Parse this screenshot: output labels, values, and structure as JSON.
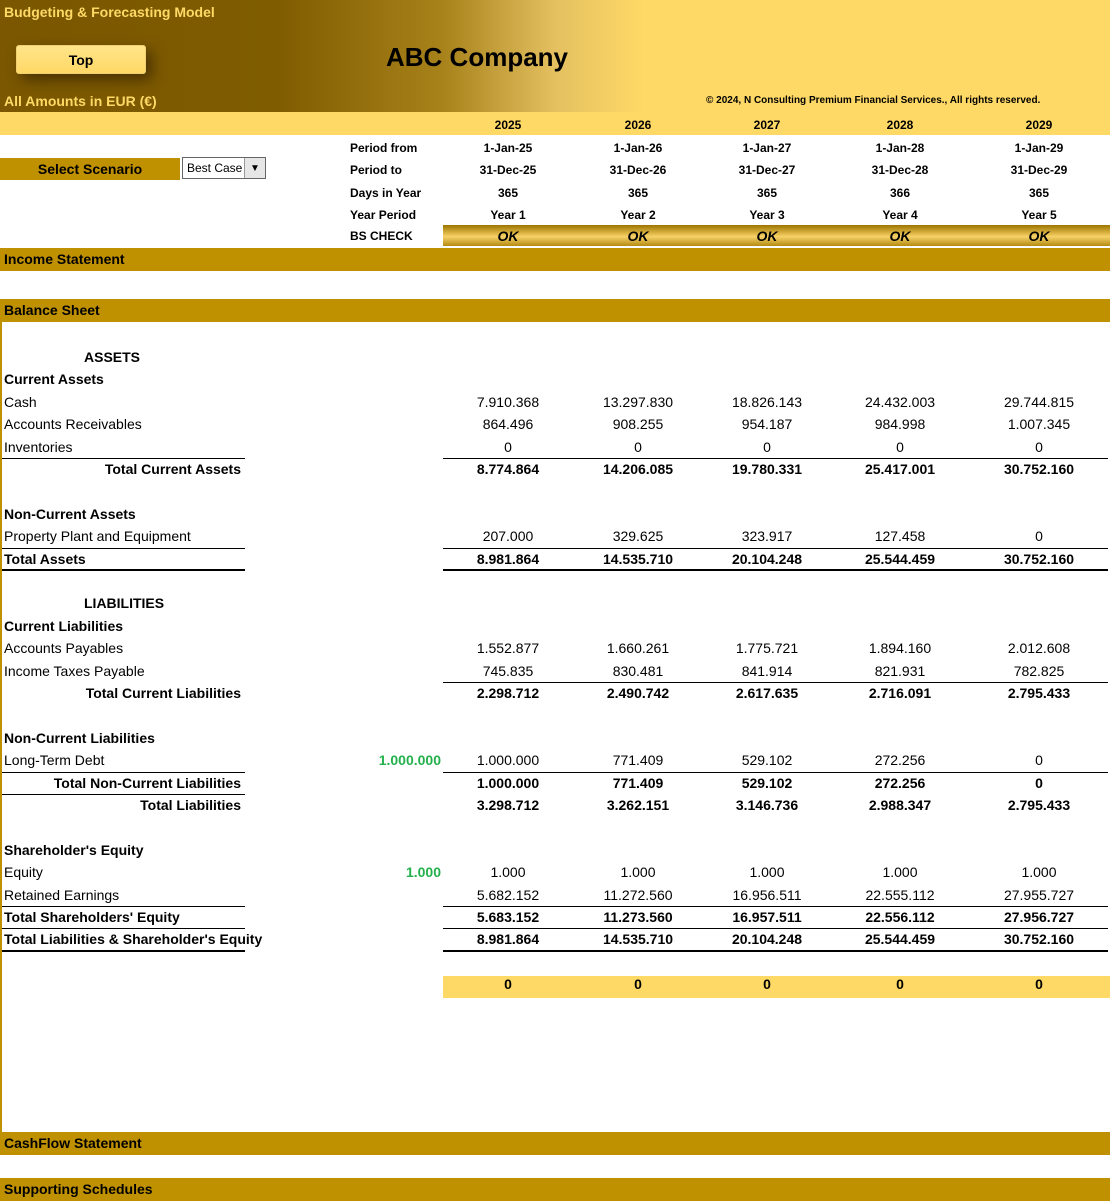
{
  "app_title": "Budgeting & Forecasting  Model",
  "top_button": "Top",
  "company": "ABC Company",
  "amounts_note": "All Amounts in  EUR (€)",
  "copyright": "© 2024, N Consulting Premium Financial Services., All rights reserved.",
  "colors": {
    "gold": "#bf9000",
    "light_gold": "#ffd966",
    "dark_brown": "#7a5700",
    "input_green": "#22b14c"
  },
  "scenario": {
    "label": "Select Scenario",
    "value": "Best Case",
    "icon": "chevron-down-icon"
  },
  "years": [
    "2025",
    "2026",
    "2027",
    "2028",
    "2029"
  ],
  "params": [
    {
      "label": "Period from",
      "values": [
        "1-Jan-25",
        "1-Jan-26",
        "1-Jan-27",
        "1-Jan-28",
        "1-Jan-29"
      ]
    },
    {
      "label": "Period to",
      "values": [
        "31-Dec-25",
        "31-Dec-26",
        "31-Dec-27",
        "31-Dec-28",
        "31-Dec-29"
      ]
    },
    {
      "label": "Days in Year",
      "values": [
        "365",
        "365",
        "365",
        "366",
        "365"
      ]
    },
    {
      "label": "Year Period",
      "values": [
        "Year 1",
        "Year 2",
        "Year 3",
        "Year 4",
        "Year 5"
      ]
    },
    {
      "label": "BS CHECK",
      "values": [
        "OK",
        "OK",
        "OK",
        "OK",
        "OK"
      ]
    }
  ],
  "sections": {
    "income": "Income Statement",
    "balance": "Balance Sheet",
    "cashflow": "CashFlow Statement",
    "supporting": "Supporting Schedules"
  },
  "balance_sheet": [
    {
      "label": "ASSETS",
      "kind": "title"
    },
    {
      "label": "Current Assets",
      "kind": "header"
    },
    {
      "label": "Cash",
      "values": [
        "7.910.368",
        "13.297.830",
        "18.826.143",
        "24.432.003",
        "29.744.815"
      ]
    },
    {
      "label": "Accounts Receivables",
      "values": [
        "864.496",
        "908.255",
        "954.187",
        "984.998",
        "1.007.345"
      ]
    },
    {
      "label": "Inventories",
      "values": [
        "0",
        "0",
        "0",
        "0",
        "0"
      ]
    },
    {
      "label": "Total Current Assets",
      "kind": "total-indent",
      "values": [
        "8.774.864",
        "14.206.085",
        "19.780.331",
        "25.417.001",
        "30.752.160"
      ]
    },
    {
      "label": "Non-Current Assets",
      "kind": "header"
    },
    {
      "label": "Property Plant and Equipment",
      "values": [
        "207.000",
        "329.625",
        "323.917",
        "127.458",
        "0"
      ]
    },
    {
      "label": "Total Assets",
      "kind": "total",
      "values": [
        "8.981.864",
        "14.535.710",
        "20.104.248",
        "25.544.459",
        "30.752.160"
      ]
    },
    {
      "label": "LIABILITIES",
      "kind": "title"
    },
    {
      "label": "Current Liabilities",
      "kind": "header"
    },
    {
      "label": "Accounts Payables",
      "values": [
        "1.552.877",
        "1.660.261",
        "1.775.721",
        "1.894.160",
        "2.012.608"
      ]
    },
    {
      "label": "Income Taxes Payable",
      "values": [
        "745.835",
        "830.481",
        "841.914",
        "821.931",
        "782.825"
      ]
    },
    {
      "label": "Total Current Liabilities",
      "kind": "total-indent",
      "values": [
        "2.298.712",
        "2.490.742",
        "2.617.635",
        "2.716.091",
        "2.795.433"
      ]
    },
    {
      "label": "Non-Current Liabilities",
      "kind": "header"
    },
    {
      "label": "Long-Term Debt",
      "initial": "1.000.000",
      "values": [
        "1.000.000",
        "771.409",
        "529.102",
        "272.256",
        "0"
      ]
    },
    {
      "label": "Total Non-Current Liabilities",
      "kind": "total-indent",
      "values": [
        "1.000.000",
        "771.409",
        "529.102",
        "272.256",
        "0"
      ]
    },
    {
      "label": "Total Liabilities",
      "kind": "total-indent",
      "values": [
        "3.298.712",
        "3.262.151",
        "3.146.736",
        "2.988.347",
        "2.795.433"
      ]
    },
    {
      "label": "Shareholder's Equity",
      "kind": "header"
    },
    {
      "label": "Equity",
      "initial": "1.000",
      "values": [
        "1.000",
        "1.000",
        "1.000",
        "1.000",
        "1.000"
      ]
    },
    {
      "label": "Retained Earnings",
      "values": [
        "5.682.152",
        "11.272.560",
        "16.956.511",
        "22.555.112",
        "27.955.727"
      ]
    },
    {
      "label": "Total Shareholders' Equity",
      "kind": "total",
      "values": [
        "5.683.152",
        "11.273.560",
        "16.957.511",
        "22.556.112",
        "27.956.727"
      ]
    },
    {
      "label": "Total Liabilities & Shareholder's Equity",
      "kind": "total",
      "values": [
        "8.981.864",
        "14.535.710",
        "20.104.248",
        "25.544.459",
        "30.752.160"
      ]
    },
    {
      "label": "",
      "kind": "check",
      "values": [
        "0",
        "0",
        "0",
        "0",
        "0"
      ]
    }
  ]
}
